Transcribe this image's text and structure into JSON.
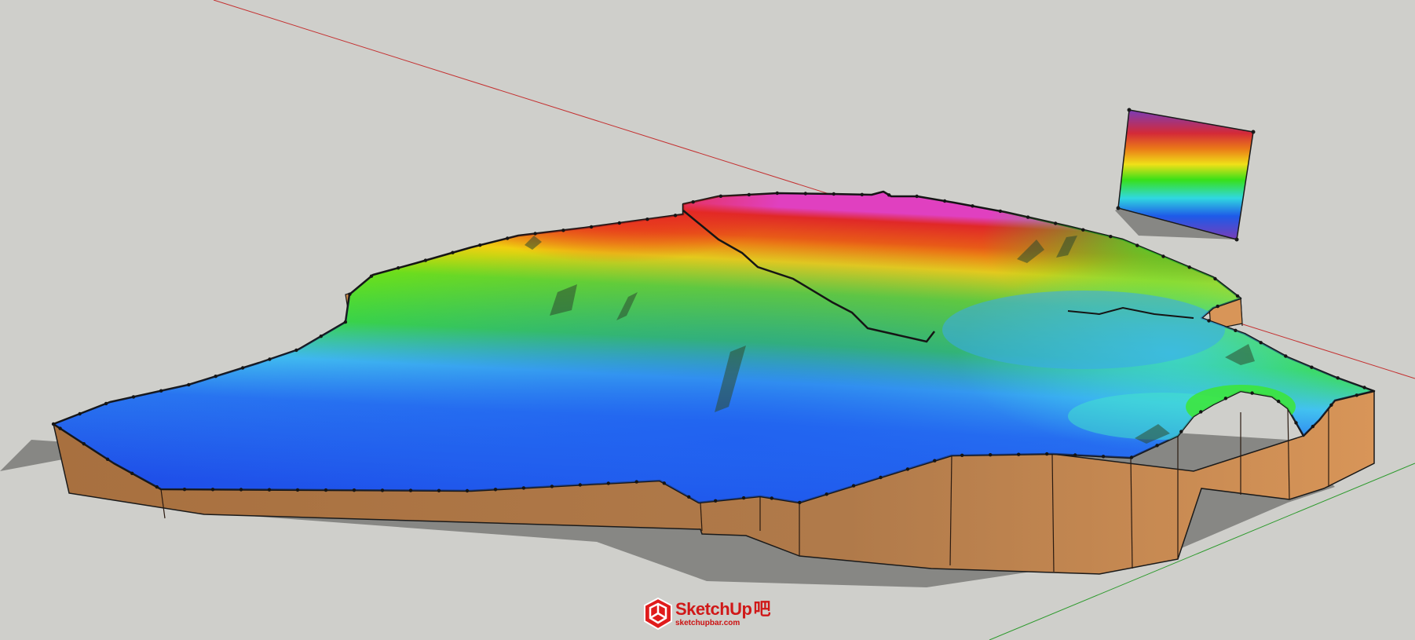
{
  "window": {
    "title": "SketchUp"
  },
  "model": {
    "name": "terrain-elevation-model",
    "colors": {
      "background": "#cfcfcb",
      "side_faces": "#b07a4a",
      "side_faces_light": "#d89558",
      "shadow": "#7a7a78",
      "red_axis": "#c43030",
      "green_axis": "#2c9a2c"
    },
    "color_ramp": [
      "#7a3db8",
      "#e0282c",
      "#e87a18",
      "#f0e018",
      "#38e018",
      "#30e0e8",
      "#1e6ae8",
      "#7a3db8"
    ]
  },
  "watermark": {
    "brand": "SketchUp",
    "suffix": "吧",
    "url": "sketchupbar.com"
  }
}
